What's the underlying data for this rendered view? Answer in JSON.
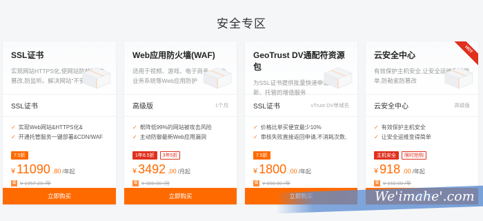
{
  "section_title": "安全专区",
  "cards": [
    {
      "name": "SSL证书",
      "desc": "实现网站HTTPS化,使网站防劫持,防篡改,防监听。解决网站\"不安全\"提示",
      "edition": "SSL证书",
      "edition_note": "",
      "features": [
        "实现Web网站&HTTPS化&",
        "开通托管服务一键部署&CDN/WAF"
      ],
      "tags": [
        {
          "text": "7.5折",
          "style": "solid"
        }
      ],
      "currency": "¥",
      "price_int": "11090",
      "price_dec": ".80",
      "price_unit": "/年起",
      "orig_icon": "省",
      "orig_price": "¥ 1957.20 /年",
      "buy_label": "立即购买",
      "hot": false
    },
    {
      "name": "Web应用防火墙(WAF)",
      "desc": "适用于视频、游戏、电子商务、企业业务系统等Web应用防护",
      "edition": "高级版",
      "edition_note": "1个月",
      "features": [
        "帮阵低99%的网站被攻击风险",
        "主动防御最新Web应用漏洞"
      ],
      "tags": [
        {
          "text": "1年8.5折",
          "style": "red-solid"
        },
        {
          "text": "3年5折",
          "style": "red"
        }
      ],
      "currency": "¥",
      "price_int": "3492",
      "price_dec": ".00",
      "price_unit": "/月起",
      "orig_icon": "省",
      "orig_price": "¥ 388.00 /月",
      "buy_label": "立即购买",
      "hot": false
    },
    {
      "name": "GeoTrust DV通配符资源包",
      "desc": "为SSL证书提供批量快速申请、更新、托管的增值服务",
      "edition": "SSL证书",
      "edition_note": "vTrust DV单域名",
      "features": [
        "价格比单买便宜最少10%",
        "审核失败直接返回申请,不消耗次数,"
      ],
      "tags": [
        {
          "text": "7.5折",
          "style": "solid"
        }
      ],
      "currency": "¥",
      "price_int": "1800",
      "price_dec": ".00",
      "price_unit": "/年起",
      "orig_icon": "省",
      "orig_price": "¥ 600.00 /年",
      "buy_label": "立即购买",
      "hot": false
    },
    {
      "name": "云安全中心",
      "desc": "有效保护主机安全,让安全运维变得简单,防勒索防篡改",
      "edition": "云安全中心",
      "edition_note": "高级版",
      "features": [
        "有效保护主机安全",
        "让安全运维变得简单"
      ],
      "tags": [
        {
          "text": "主机安全",
          "style": "red-solid"
        },
        {
          "text": "限时抢购",
          "style": "red"
        }
      ],
      "currency": "¥",
      "price_int": "918",
      "price_dec": ".00",
      "price_unit": "/年起",
      "orig_icon": "省",
      "orig_price": "¥ 162.00 /年",
      "buy_label": "立即购买",
      "hot": true,
      "hot_label": "HOT"
    }
  ],
  "watermark": "We'imahe'.com",
  "colors": {
    "accent": "#ff6a00",
    "red": "#e0301e",
    "background": "#f5f6f8"
  }
}
